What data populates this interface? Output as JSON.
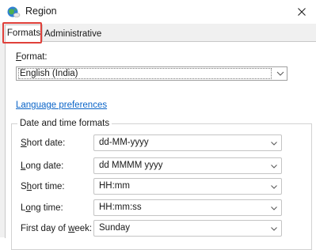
{
  "window": {
    "title": "Region"
  },
  "tabs": [
    {
      "label": "Formats",
      "selected": true
    },
    {
      "label": "Administrative",
      "selected": false
    }
  ],
  "format": {
    "label_underlined": "F",
    "label_rest": "ormat:",
    "selected_value": "English (India)"
  },
  "language_link": "Language preferences",
  "date_time_group": {
    "title": "Date and time formats",
    "rows": [
      {
        "label_underlined": "S",
        "label_rest": "hort date:",
        "value": "dd-MM-yyyy"
      },
      {
        "label_underlined": "L",
        "label_rest": "ong date:",
        "value": "dd MMMM yyyy"
      },
      {
        "label_pre": "S",
        "label_underlined": "h",
        "label_rest": "ort time:",
        "value": "HH:mm"
      },
      {
        "label_pre": "L",
        "label_underlined": "o",
        "label_rest": "ng time:",
        "value": "HH:mm:ss"
      },
      {
        "label_pre": "First day of ",
        "label_underlined": "w",
        "label_rest": "eek:",
        "value": "Sunday"
      }
    ]
  },
  "colors": {
    "highlight": "#e0403a",
    "link": "#0a64c8"
  },
  "icons": {
    "app": "globe-icon",
    "close": "close-icon",
    "dropdown": "chevron-down-icon"
  }
}
